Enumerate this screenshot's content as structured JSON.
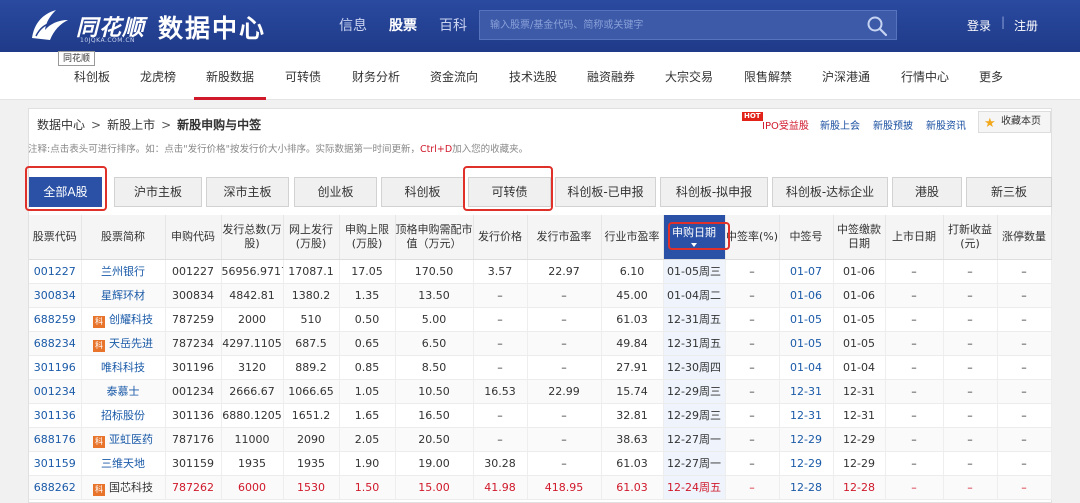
{
  "header": {
    "logo_text": "同花顺",
    "logo_url": "10JQKA.COM.CN",
    "site_title": "数据中心",
    "nav": [
      {
        "label": "信息",
        "active": false
      },
      {
        "label": "股票",
        "active": true
      },
      {
        "label": "百科",
        "active": false
      }
    ],
    "search": {
      "placeholder": "输入股票/基金代码、简称或关键字"
    },
    "login": "登录",
    "register": "注册",
    "separator": "|"
  },
  "subnav": {
    "tooltip": "同花顺",
    "items": [
      "科创板",
      "龙虎榜",
      "新股数据",
      "可转债",
      "财务分析",
      "资金流向",
      "技术选股",
      "融资融券",
      "大宗交易",
      "限售解禁",
      "沪深港通",
      "行情中心",
      "更多"
    ],
    "active_index": 2
  },
  "breadcrumb": {
    "items": [
      "数据中心",
      "新股上市",
      "新股申购与中签"
    ],
    "sep": ">"
  },
  "quick_links": {
    "hot_badge": "HOT",
    "items": [
      "IPO受益股",
      "新股上会",
      "新股预披",
      "新股资讯"
    ],
    "favorite": "收藏本页"
  },
  "note": {
    "text": "注释:点击表头可进行排序。如：点击\"发行价格\"按发行价大小排序。实际数据第一时间更新，",
    "shortcut": "Ctrl+D",
    "suffix": "加入您的收藏夹。"
  },
  "tabs": [
    "全部A股",
    "沪市主板",
    "深市主板",
    "创业板",
    "科创板",
    "可转债",
    "科创板-已申报",
    "科创板-拟申报",
    "科创板-达标企业",
    "港股",
    "新三板"
  ],
  "active_tab": 0,
  "table": {
    "headers": [
      "股票代码",
      "股票简称",
      "申购代码",
      "发行总数(万股)",
      "网上发行(万股)",
      "申购上限(万股)",
      "顶格申购需配市值（万元）",
      "发行价格",
      "发行市盈率",
      "行业市盈率",
      "申购日期",
      "中签率(%)",
      "中签号",
      "中签缴款日期",
      "上市日期",
      "打新收益(元)",
      "涨停数量"
    ],
    "sorted_col": 10,
    "rows": [
      {
        "code": "001227",
        "name": "兰州银行",
        "ke": false,
        "sub": "001227",
        "total": "56956.9717",
        "online": "17087.1",
        "limit": "17.05",
        "cap": "170.50",
        "price": "3.57",
        "pe": "22.97",
        "ind_pe": "6.10",
        "date": "01-05周三",
        "rate": "–",
        "lucky": "01-07",
        "pay": "01-06",
        "list": "–",
        "gain": "–",
        "up": "–",
        "red": false
      },
      {
        "code": "300834",
        "name": "星辉环材",
        "ke": false,
        "sub": "300834",
        "total": "4842.81",
        "online": "1380.2",
        "limit": "1.35",
        "cap": "13.50",
        "price": "–",
        "pe": "–",
        "ind_pe": "45.00",
        "date": "01-04周二",
        "rate": "–",
        "lucky": "01-06",
        "pay": "01-06",
        "list": "–",
        "gain": "–",
        "up": "–",
        "red": false
      },
      {
        "code": "688259",
        "name": "创耀科技",
        "ke": true,
        "sub": "787259",
        "total": "2000",
        "online": "510",
        "limit": "0.50",
        "cap": "5.00",
        "price": "–",
        "pe": "–",
        "ind_pe": "61.03",
        "date": "12-31周五",
        "rate": "–",
        "lucky": "01-05",
        "pay": "01-05",
        "list": "–",
        "gain": "–",
        "up": "–",
        "red": false
      },
      {
        "code": "688234",
        "name": "天岳先进",
        "ke": true,
        "sub": "787234",
        "total": "4297.1105",
        "online": "687.5",
        "limit": "0.65",
        "cap": "6.50",
        "price": "–",
        "pe": "–",
        "ind_pe": "49.84",
        "date": "12-31周五",
        "rate": "–",
        "lucky": "01-05",
        "pay": "01-05",
        "list": "–",
        "gain": "–",
        "up": "–",
        "red": false
      },
      {
        "code": "301196",
        "name": "唯科科技",
        "ke": false,
        "sub": "301196",
        "total": "3120",
        "online": "889.2",
        "limit": "0.85",
        "cap": "8.50",
        "price": "–",
        "pe": "–",
        "ind_pe": "27.91",
        "date": "12-30周四",
        "rate": "–",
        "lucky": "01-04",
        "pay": "01-04",
        "list": "–",
        "gain": "–",
        "up": "–",
        "red": false
      },
      {
        "code": "001234",
        "name": "泰慕士",
        "ke": false,
        "sub": "001234",
        "total": "2666.67",
        "online": "1066.65",
        "limit": "1.05",
        "cap": "10.50",
        "price": "16.53",
        "pe": "22.99",
        "ind_pe": "15.74",
        "date": "12-29周三",
        "rate": "–",
        "lucky": "12-31",
        "pay": "12-31",
        "list": "–",
        "gain": "–",
        "up": "–",
        "red": false
      },
      {
        "code": "301136",
        "name": "招标股份",
        "ke": false,
        "sub": "301136",
        "total": "6880.1205",
        "online": "1651.2",
        "limit": "1.65",
        "cap": "16.50",
        "price": "–",
        "pe": "–",
        "ind_pe": "32.81",
        "date": "12-29周三",
        "rate": "–",
        "lucky": "12-31",
        "pay": "12-31",
        "list": "–",
        "gain": "–",
        "up": "–",
        "red": false
      },
      {
        "code": "688176",
        "name": "亚虹医药",
        "ke": true,
        "sub": "787176",
        "total": "11000",
        "online": "2090",
        "limit": "2.05",
        "cap": "20.50",
        "price": "–",
        "pe": "–",
        "ind_pe": "38.63",
        "date": "12-27周一",
        "rate": "–",
        "lucky": "12-29",
        "pay": "12-29",
        "list": "–",
        "gain": "–",
        "up": "–",
        "red": false
      },
      {
        "code": "301159",
        "name": "三维天地",
        "ke": false,
        "sub": "301159",
        "total": "1935",
        "online": "1935",
        "limit": "1.90",
        "cap": "19.00",
        "price": "30.28",
        "pe": "–",
        "ind_pe": "61.03",
        "date": "12-27周一",
        "rate": "–",
        "lucky": "12-29",
        "pay": "12-29",
        "list": "–",
        "gain": "–",
        "up": "–",
        "red": false
      },
      {
        "code": "688262",
        "name": "国芯科技",
        "ke": true,
        "sub": "787262",
        "total": "6000",
        "online": "1530",
        "limit": "1.50",
        "cap": "15.00",
        "price": "41.98",
        "pe": "418.95",
        "ind_pe": "61.03",
        "date": "12-24周五",
        "rate": "–",
        "lucky": "12-28",
        "pay": "12-28",
        "list": "–",
        "gain": "–",
        "up": "–",
        "red": true
      }
    ]
  },
  "colors": {
    "brand": "#233f8e",
    "accent_red": "#d0192b",
    "link": "#1a5aa8",
    "highlight_box": "#e0302a"
  }
}
